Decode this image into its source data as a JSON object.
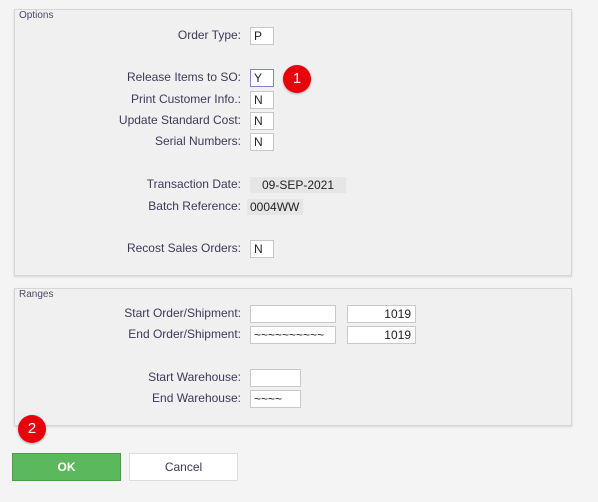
{
  "options": {
    "title": "Options",
    "order_type_label": "Order Type:",
    "order_type_value": "P",
    "release_items_label": "Release Items to SO:",
    "release_items_value": "Y",
    "print_customer_label": "Print Customer Info.:",
    "print_customer_value": "N",
    "update_cost_label": "Update Standard Cost:",
    "update_cost_value": "N",
    "serial_numbers_label": "Serial Numbers:",
    "serial_numbers_value": "N",
    "transaction_date_label": "Transaction Date:",
    "transaction_date_value": "09-SEP-2021",
    "batch_reference_label": "Batch Reference:",
    "batch_reference_value": "0004WW",
    "recost_label": "Recost Sales Orders:",
    "recost_value": "N"
  },
  "ranges": {
    "title": "Ranges",
    "start_order_label": "Start Order/Shipment:",
    "start_order_from": "",
    "start_order_to": "1019",
    "end_order_label": "End Order/Shipment:",
    "end_order_from": "~~~~~~~~~~",
    "end_order_to": "1019",
    "start_warehouse_label": "Start Warehouse:",
    "start_warehouse_value": "",
    "end_warehouse_label": "End Warehouse:",
    "end_warehouse_value": "~~~~"
  },
  "annotations": {
    "marker_1": "1",
    "marker_2": "2"
  },
  "buttons": {
    "ok_label": "OK",
    "cancel_label": "Cancel"
  },
  "colors": {
    "ok_button": "#5cb85c",
    "marker": "#e8000d",
    "focus_border": "#7f85c9"
  }
}
